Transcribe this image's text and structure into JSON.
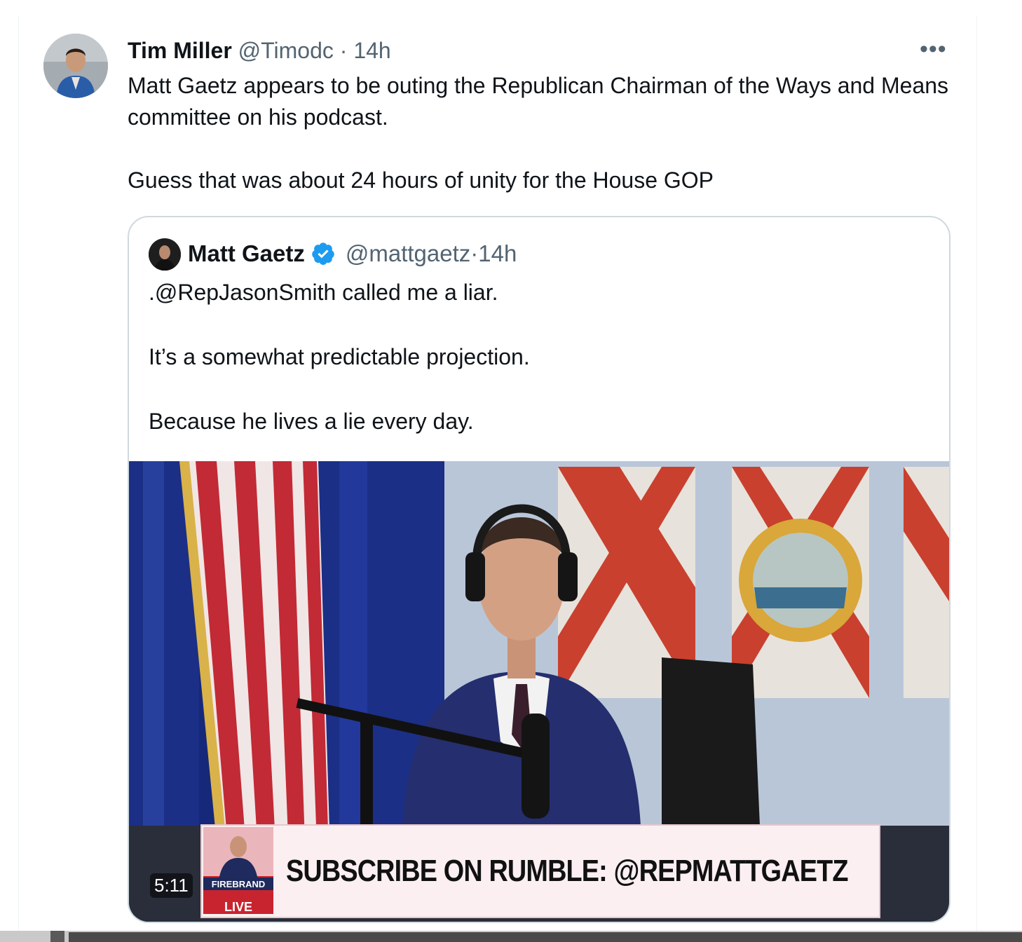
{
  "tweet": {
    "author_name": "Tim Miller",
    "author_handle": "@Timodc",
    "separator": "·",
    "time": "14h",
    "more_label": "•••",
    "text_line1": "Matt Gaetz appears to be outing the Republican Chairman of the Ways and Means committee on his podcast.",
    "text_line2": "Guess that was about 24 hours of unity for the House GOP"
  },
  "quoted_tweet": {
    "author_name": "Matt Gaetz",
    "author_handle": "@mattgaetz",
    "separator": "·",
    "time": "14h",
    "verified": true,
    "text_line1": ".@RepJasonSmith called me a liar.",
    "text_line2": "It’s a somewhat predictable projection.",
    "text_line3": "Because he lives a lie every day.",
    "video": {
      "duration": "5:11",
      "banner_text": "SUBSCRIBE ON RUMBLE: @REPMATTGAETZ",
      "logo_text": "FIREBRAND",
      "live_text": "LIVE"
    }
  },
  "colors": {
    "text_primary": "#0f1419",
    "text_secondary": "#536471",
    "border": "#cfd9de",
    "verified_blue": "#1d9bf0"
  },
  "icons": [
    "more-icon",
    "verified-badge-icon"
  ]
}
